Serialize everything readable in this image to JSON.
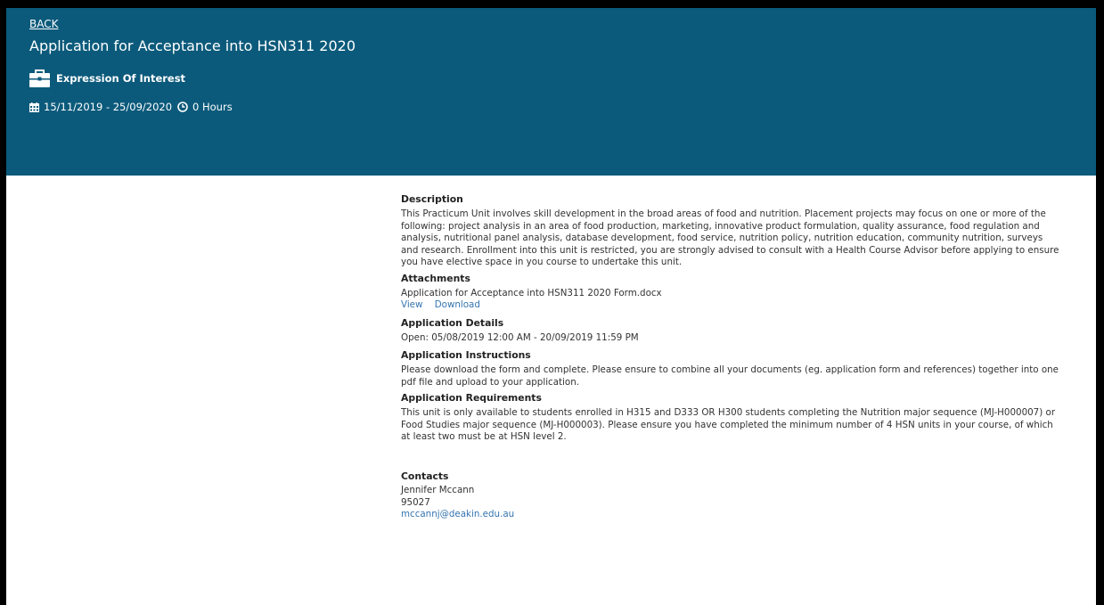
{
  "header": {
    "back_label": "BACK",
    "title": "Application for Acceptance into HSN311 2020",
    "type_label": "Expression Of Interest",
    "type_icon": "briefcase-icon",
    "date_range": "15/11/2019 - 25/09/2020",
    "hours": "0 Hours",
    "banner_color": "#0b5a7b"
  },
  "description": {
    "heading": "Description",
    "text": "This Practicum Unit involves skill development in the broad areas of food and nutrition. Placement projects may focus on one or more of the following: project analysis in an area of food production, marketing, innovative product formulation, quality assurance, food regulation and analysis, nutritional panel analysis, database development, food service, nutrition policy, nutrition education, community nutrition, surveys and research. Enrollment into this unit is restricted, you are strongly advised to consult with a Health Course Advisor before applying to ensure you have elective space in you course to undertake this unit."
  },
  "attachments": {
    "heading": "Attachments",
    "file_name": "Application for Acceptance into HSN311 2020 Form.docx",
    "view_label": "View",
    "download_label": "Download"
  },
  "application_details": {
    "heading": "Application Details",
    "open_text": "Open: 05/08/2019 12:00 AM - 20/09/2019 11:59 PM"
  },
  "application_instructions": {
    "heading": "Application Instructions",
    "text": "Please download the form and complete. Please ensure to combine all your documents (eg. application form and references) together into one pdf file and upload to your application."
  },
  "application_requirements": {
    "heading": "Application Requirements",
    "text": "This unit is only available to students enrolled in H315 and D333 OR H300 students completing the Nutrition major sequence (MJ-H000007) or Food Studies major sequence (MJ-H000003). Please ensure you have completed the minimum number of 4 HSN units in your course, of which at least two must be at HSN level 2."
  },
  "contacts": {
    "heading": "Contacts",
    "name": "Jennifer Mccann",
    "phone": "95027",
    "email": "mccannj@deakin.edu.au",
    "link_color": "#3575b0"
  }
}
